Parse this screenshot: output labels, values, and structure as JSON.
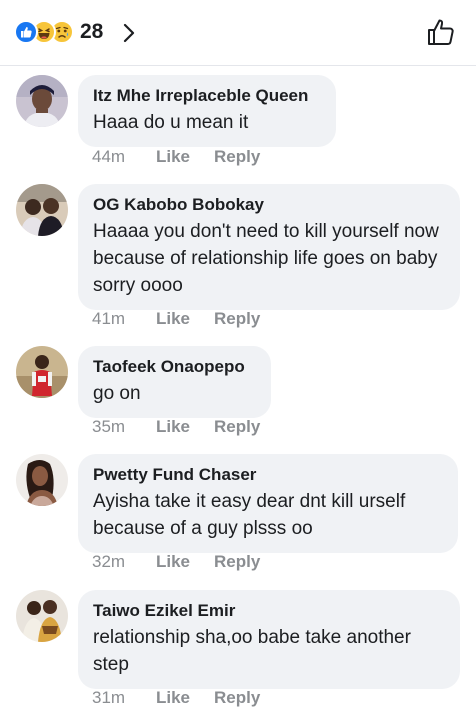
{
  "reactions": {
    "count": "28",
    "types": [
      "like-icon",
      "haha-icon",
      "sad-icon"
    ]
  },
  "comments": [
    {
      "author": "Itz Mhe Irreplaceble Queen",
      "text": "Haaa do u mean it",
      "time": "44m",
      "like": "Like",
      "reply": "Reply"
    },
    {
      "author": "OG Kabobo Bobokay",
      "text": "Haaaa you don't need to kill yourself now because of relationship life goes on baby sorry oooo",
      "time": "41m",
      "like": "Like",
      "reply": "Reply"
    },
    {
      "author": "Taofeek Onaopepo",
      "text": "go on",
      "time": "35m",
      "like": "Like",
      "reply": "Reply"
    },
    {
      "author": "Pwetty Fund Chaser",
      "text": "Ayisha take it easy dear dnt kill urself because of a guy plsss oo",
      "time": "32m",
      "like": "Like",
      "reply": "Reply"
    },
    {
      "author": "Taiwo Ezikel Emir",
      "text": "relationship sha,oo babe take another step",
      "time": "31m",
      "like": "Like",
      "reply": "Reply"
    }
  ],
  "colors": {
    "bubble": "#f0f2f5",
    "meta": "#8a8d91",
    "like_blue": "#1877f2",
    "emoji_yellow": "#f7c53a"
  }
}
